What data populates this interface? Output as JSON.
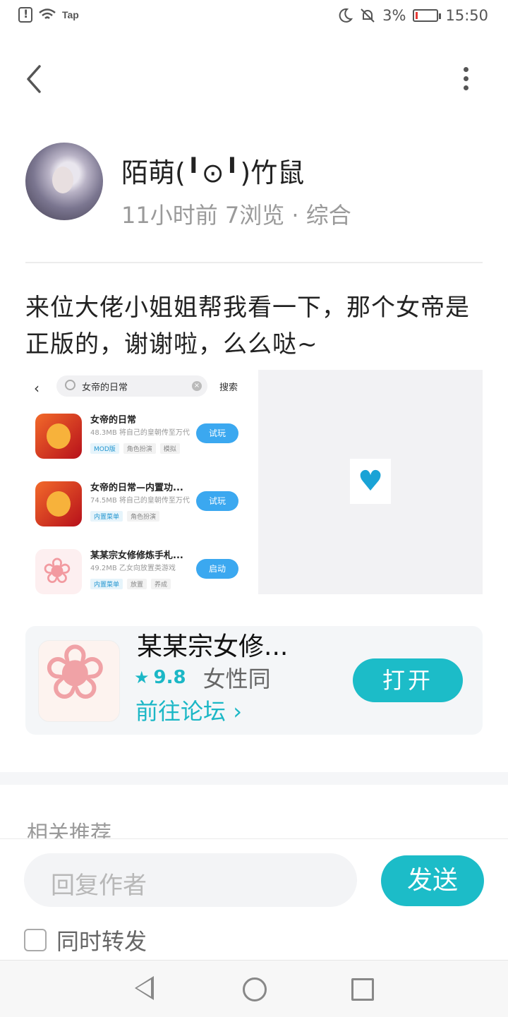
{
  "status_bar": {
    "carrier_label": "Tap",
    "battery": "3%",
    "time": "15:50",
    "icons": [
      "alert-icon",
      "wifi-icon",
      "moon-icon",
      "mute-bell-icon",
      "battery-icon"
    ]
  },
  "header": {
    "back_icon": "chevron-left-icon",
    "more_icon": "more-vertical-icon"
  },
  "post": {
    "author": "陌萌(╹⊙╹)竹鼠",
    "meta": "11小时前 7浏览 · 综合",
    "text": "来位大佬小姐姐帮我看一下，那个女帝是正版的，谢谢啦，么么哒~"
  },
  "screenshot": {
    "search_query": "女帝的日常",
    "search_button": "搜索",
    "items": [
      {
        "name": "女帝的日常",
        "sub": "48.3MB 将自己的皇朝传至万代",
        "tags": [
          "MOD版",
          "角色扮演",
          "模拟"
        ],
        "button": "试玩",
        "icon": "dragon-icon"
      },
      {
        "name": "女帝的日常—内置功...",
        "sub": "74.5MB 将自己的皇朝传至万代",
        "tags": [
          "内置菜单",
          "角色扮演"
        ],
        "button": "试玩",
        "icon": "dragon-icon"
      },
      {
        "name": "某某宗女修修炼手札...",
        "sub": "49.2MB 乙女向放置类游戏",
        "tags": [
          "内置菜单",
          "放置",
          "养成"
        ],
        "button": "启动",
        "icon": "blossom-icon"
      }
    ],
    "right_icon": "heart-icon"
  },
  "app_card": {
    "name": "某某宗女修...",
    "rating": "9.8",
    "category": "女性同",
    "forum_link": "前往论坛",
    "open_button": "打开",
    "icon": "blossom-icon"
  },
  "related": {
    "title": "相关推荐"
  },
  "reply": {
    "placeholder": "回复作者",
    "send_button": "发送",
    "forward_label": "同时转发"
  },
  "nav": {
    "icons": [
      "nav-back-icon",
      "nav-home-icon",
      "nav-recents-icon"
    ]
  },
  "colors": {
    "accent": "#1cbcc8",
    "meta_text": "#9a9a9a",
    "card_bg": "#f4f6f8"
  }
}
